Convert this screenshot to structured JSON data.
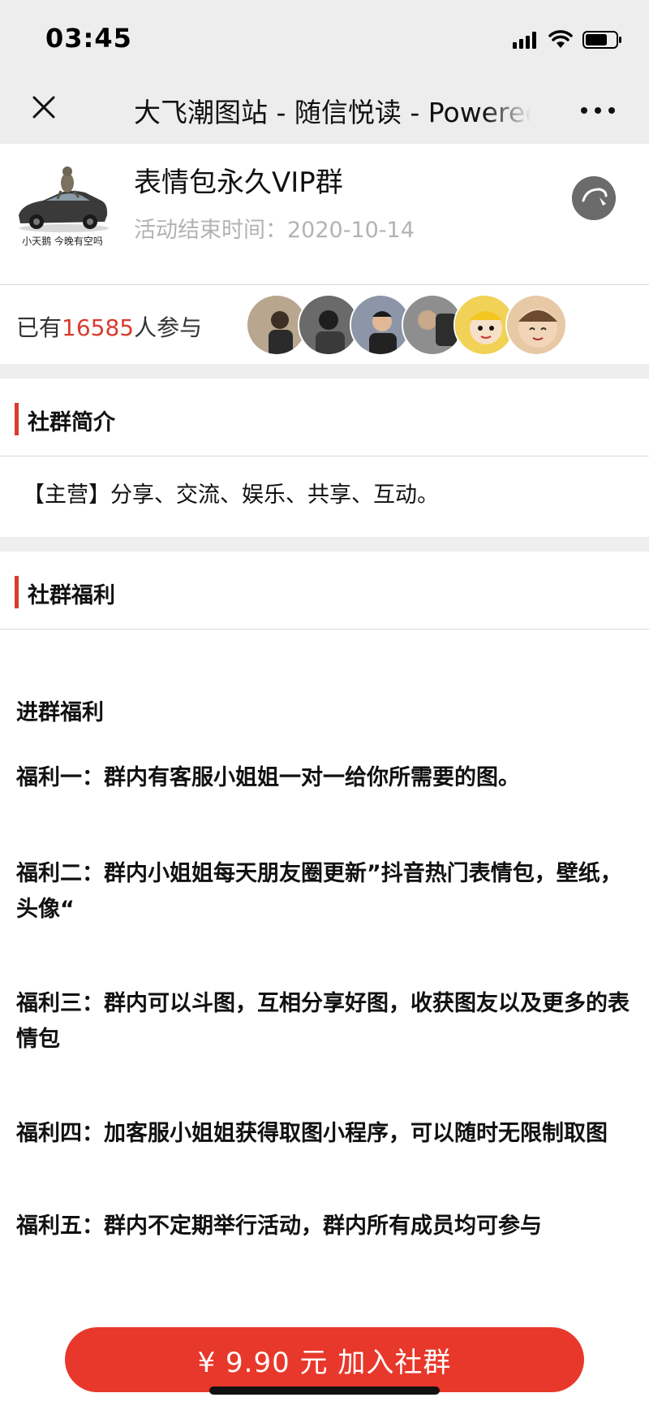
{
  "status_bar": {
    "time": "03:45"
  },
  "nav": {
    "title": "大飞潮图站 - 随信悦读 - Powered by 随信悦读"
  },
  "group": {
    "cover_caption": "小天鹅 今晚有空吗",
    "name": "表情包永久VIP群",
    "end_time": "活动结束时间：2020-10-14"
  },
  "participants": {
    "prefix": "已有",
    "count": "16585",
    "suffix": "人参与",
    "avatar_colors": [
      "#b9a68e",
      "#6a6a6a",
      "#8d96a8",
      "#8e8e8e",
      "#f1d256",
      "#e7c9a6"
    ]
  },
  "intro": {
    "section_title": "社群简介",
    "text": "【主营】分享、交流、娱乐、共享、互动。"
  },
  "benefits": {
    "section_title": "社群福利",
    "items": [
      " 进群福利",
      " 福利一：群内有客服小姐姐一对一给你所需要的图。",
      " 福利二：群内小姐姐每天朋友圈更新”抖音热门表情包，壁纸，头像“",
      " 福利三：群内可以斗图，互相分享好图，收获图友以及更多的表情包",
      " 福利四：加客服小姐姐获得取图小程序，可以随时无限制取图",
      " 福利五：群内不定期举行活动，群内所有成员均可参与"
    ]
  },
  "join_button": {
    "label": "¥  9.90 元 加入社群"
  },
  "colors": {
    "accent": "#e8382b",
    "count_red": "#d83b2f",
    "muted": "#b3b3b3"
  }
}
